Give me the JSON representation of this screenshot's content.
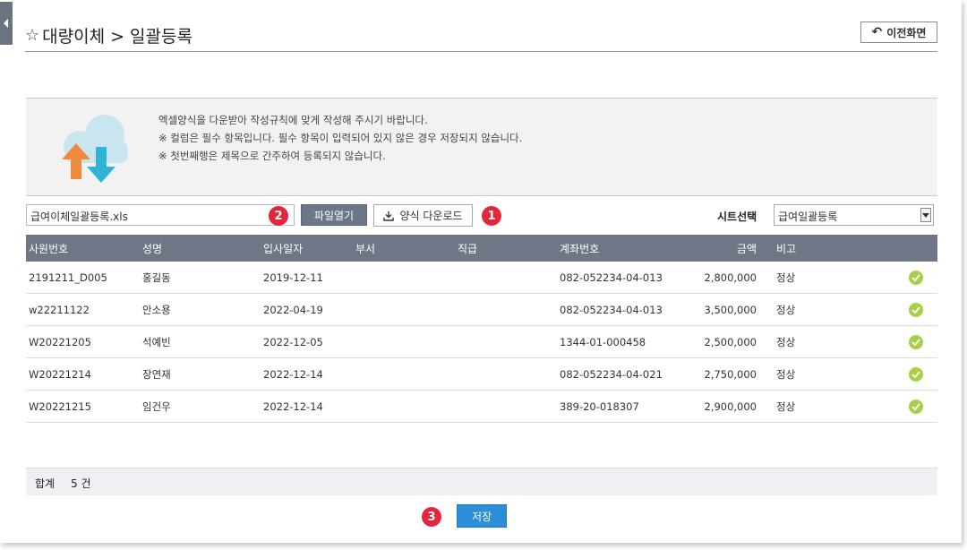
{
  "page": {
    "title": "대량이체 > 일괄등록",
    "prev_button": "이전화면"
  },
  "info": {
    "lines": [
      "엑셀양식을 다운받아 작성규칙에 맞게 작성해 주시기 바랍니다.",
      "※ 컬럼은 필수 항목입니다. 필수 항목이 입력되어 있지 않은 경우 저장되지 않습니다.",
      "※ 첫번째행은 제목으로 간주하여 등록되지 않습니다."
    ]
  },
  "toolbar": {
    "file_name": "급여이체일괄등록.xls",
    "open_button": "파일열기",
    "download_button": "양식 다운로드",
    "sheet_label": "시트선택",
    "sheet_selected": "급여일괄등록",
    "badges": {
      "download": "1",
      "file": "2",
      "save": "3"
    }
  },
  "table": {
    "columns": [
      "사원번호",
      "성명",
      "입사일자",
      "부서",
      "직급",
      "계좌번호",
      "금액",
      "비고"
    ],
    "rows": [
      {
        "id": "2191211_D005",
        "name": "홍길동",
        "date": "2019-12-11",
        "dept": "",
        "rank": "",
        "account": "082-052234-04-013",
        "amount": "2,800,000",
        "note": "정상"
      },
      {
        "id": "w22211122",
        "name": "안소용",
        "date": "2022-04-19",
        "dept": "",
        "rank": "",
        "account": "082-052234-04-013",
        "amount": "3,500,000",
        "note": "정상"
      },
      {
        "id": "W20221205",
        "name": "석예빈",
        "date": "2022-12-05",
        "dept": "",
        "rank": "",
        "account": "1344-01-000458",
        "amount": "2,500,000",
        "note": "정상"
      },
      {
        "id": "W20221214",
        "name": "장연재",
        "date": "2022-12-14",
        "dept": "",
        "rank": "",
        "account": "082-052234-04-021",
        "amount": "2,750,000",
        "note": "정상"
      },
      {
        "id": "W20221215",
        "name": "임건우",
        "date": "2022-12-14",
        "dept": "",
        "rank": "",
        "account": "389-20-018307",
        "amount": "2,900,000",
        "note": "정상"
      }
    ]
  },
  "summary": {
    "label": "합계",
    "count": "5 건"
  },
  "save_button": "저장",
  "colors": {
    "header_bg": "#6f7686",
    "accent_blue": "#2d8ed8",
    "badge_red": "#e3263b",
    "status_green": "#a7cf47"
  },
  "icons": [
    "star-icon",
    "back-arrow-icon",
    "cloud-upload-download-icon",
    "download-icon",
    "chevron-down-icon",
    "check-icon",
    "collapse-arrow-icon"
  ]
}
